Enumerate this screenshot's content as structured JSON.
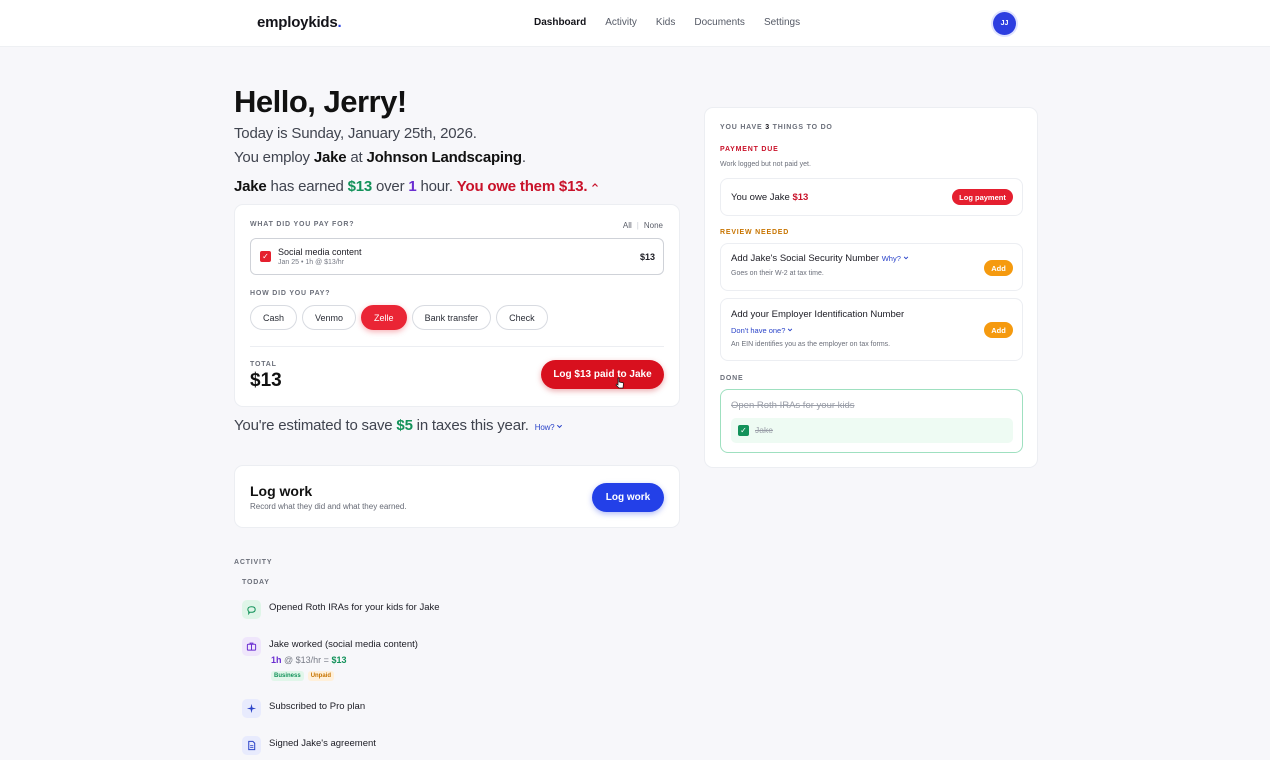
{
  "nav": {
    "logo": "employkids",
    "logo_dot": ".",
    "links": [
      "Dashboard",
      "Activity",
      "Kids",
      "Documents",
      "Settings"
    ],
    "avatar": "JJ"
  },
  "greeting": {
    "hello": "Hello, Jerry!",
    "today": "Today is Sunday, January 25th, 2026.",
    "employ_pre": "You employ ",
    "employee": "Jake",
    "employ_mid": " at ",
    "business": "Johnson Landscaping",
    "employ_end": ".",
    "earned_name": "Jake",
    "earned_pre": " has earned ",
    "earned_amount": "$13",
    "earned_mid": " over ",
    "earned_hours": "1",
    "earned_unit": " hour. ",
    "owe_text": "You owe them $13."
  },
  "payment_card": {
    "paid_for_label": "What did you pay for?",
    "all_label": "All",
    "none_label": "None",
    "item": {
      "title": "Social media content",
      "subtitle": "Jan 25 • 1h @ $13/hr",
      "amount": "$13"
    },
    "how_label": "How did you pay?",
    "methods": [
      "Cash",
      "Venmo",
      "Zelle",
      "Bank transfer",
      "Check"
    ],
    "selected_method": "Zelle",
    "total_label": "Total",
    "total_value": "$13",
    "log_button": "Log $13 paid to Jake"
  },
  "savings": {
    "pre": "You're estimated to save ",
    "amount": "$5",
    "post": " in taxes this year.",
    "how_link": "How?"
  },
  "log_work": {
    "title": "Log work",
    "subtitle": "Record what they did and what they earned.",
    "button": "Log work"
  },
  "activity": {
    "label": "Activity",
    "today_label": "Today",
    "items": [
      {
        "text": "Opened Roth IRAs for your kids for Jake"
      },
      {
        "text": "Jake worked (social media content)",
        "hours": "1h",
        "rate": " @ $13/hr = ",
        "amount": "$13",
        "tags": [
          "Business",
          "Unpaid"
        ]
      },
      {
        "text": "Subscribed to Pro plan"
      },
      {
        "text": "Signed Jake's agreement"
      }
    ]
  },
  "todo": {
    "head_pre": "You have ",
    "head_count": "3",
    "head_post": " things to do",
    "payment_due_label": "Payment due",
    "payment_due_sub": "Work logged but not paid yet.",
    "owe_pre": "You owe Jake ",
    "owe_amount": "$13",
    "log_payment": "Log payment",
    "review_label": "Review needed",
    "ssn_title": "Add Jake's Social Security Number",
    "ssn_why": "Why?",
    "ssn_sub": "Goes on their W-2 at tax time.",
    "ssn_add": "Add",
    "ein_title": "Add your Employer Identification Number",
    "ein_link": "Don't have one?",
    "ein_sub": "An EIN identifies you as the employer on tax forms.",
    "ein_add": "Add",
    "done_label": "Done",
    "done_title": "Open Roth IRAs for your kids",
    "done_item": "Jake"
  },
  "colors": {
    "accent_red": "#d8101e",
    "accent_blue": "#2340e8",
    "money_green": "#13925a",
    "hours_purple": "#6b2ed1"
  }
}
